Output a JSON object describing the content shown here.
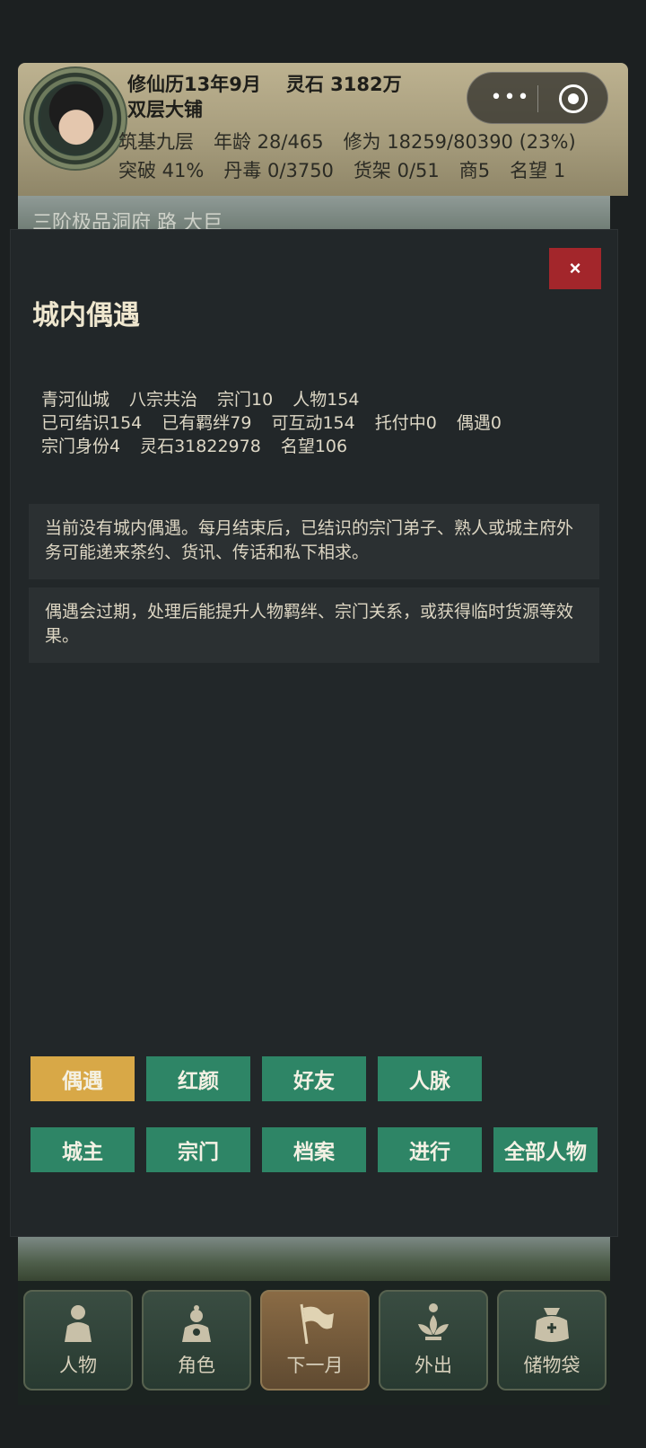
{
  "header": {
    "date": "修仙历13年9月",
    "spirit_stones": "灵石 3182万",
    "shop": "双层大铺",
    "stats_row1": [
      "筑基九层",
      "年龄 28/465",
      "修为 18259/80390 (23%)"
    ],
    "stats_row2": [
      "突破 41%",
      "丹毒 0/3750",
      "货架 0/51",
      "商5",
      "名望 1"
    ],
    "capsule_more": "•••"
  },
  "scene": {
    "title": "三阶极品洞府 路 大巨"
  },
  "modal": {
    "close_label": "×",
    "title": "城内偶遇",
    "info_line1": [
      "青河仙城",
      "八宗共治",
      "宗门10",
      "人物154"
    ],
    "info_line2": [
      "已可结识154",
      "已有羁绊79",
      "可互动154",
      "托付中0",
      "偶遇0"
    ],
    "info_line3": [
      "宗门身份4",
      "灵石31822978",
      "名望106"
    ],
    "notice1": "当前没有城内偶遇。每月结束后，已结识的宗门弟子、熟人或城主府外务可能递来茶约、货讯、传话和私下相求。",
    "notice2": "偶遇会过期，处理后能提升人物羁绊、宗门关系，或获得临时货源等效果。",
    "tabs_row1": [
      "偶遇",
      "红颜",
      "好友",
      "人脉"
    ],
    "tabs_row2": [
      "城主",
      "宗门",
      "档案",
      "进行",
      "全部人物"
    ],
    "active_tab": "偶遇",
    "colors": {
      "active_tab": "#d8a847",
      "tab": "#2e8566",
      "close": "#a3262b",
      "panel": "#222729"
    }
  },
  "bottom_nav": {
    "items": [
      {
        "label": "人物",
        "icon": "person-icon"
      },
      {
        "label": "角色",
        "icon": "character-icon"
      },
      {
        "label": "下一月",
        "icon": "flag-icon"
      },
      {
        "label": "外出",
        "icon": "lotus-icon"
      },
      {
        "label": "储物袋",
        "icon": "bag-icon"
      }
    ]
  }
}
